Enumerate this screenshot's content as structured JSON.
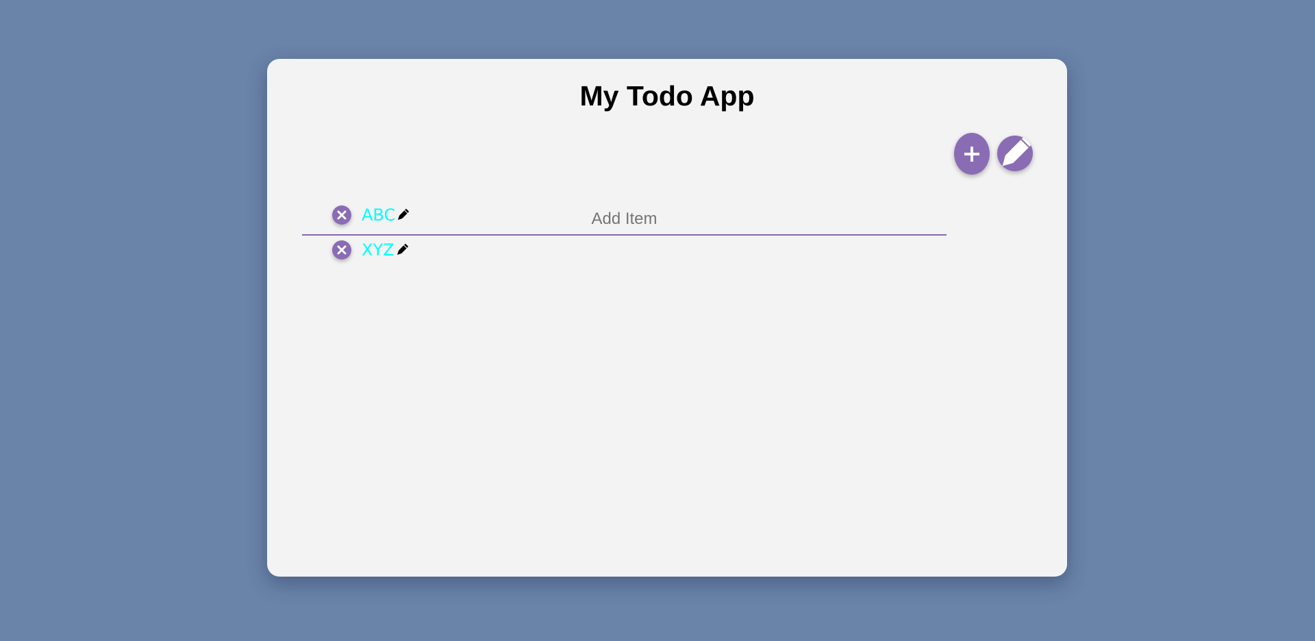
{
  "app": {
    "title": "My Todo App"
  },
  "input": {
    "placeholder": "Add Item",
    "value": ""
  },
  "buttons": {
    "add_icon": "plus-icon",
    "edit_icon": "pencil-icon"
  },
  "items": [
    {
      "text": "ABC",
      "remove_icon": "close-circle-icon",
      "edit_icon": "pencil-icon"
    },
    {
      "text": "XYZ",
      "remove_icon": "close-circle-icon",
      "edit_icon": "pencil-icon"
    }
  ],
  "colors": {
    "background": "#6a83a9",
    "card": "#f3f3f3",
    "accent": "#8a6cb5",
    "item_text": "#00ffff"
  }
}
